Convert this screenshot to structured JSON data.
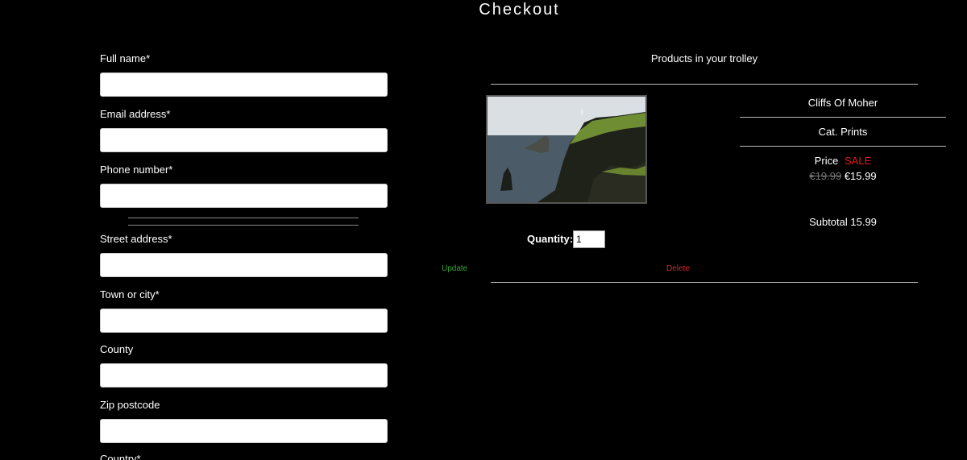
{
  "page": {
    "title": "Checkout"
  },
  "form": {
    "fields": [
      {
        "label": "Full name*",
        "value": ""
      },
      {
        "label": "Email address*",
        "value": ""
      },
      {
        "label": "Phone number*",
        "value": ""
      },
      {
        "label": "Street address*",
        "value": ""
      },
      {
        "label": "Town or city*",
        "value": ""
      },
      {
        "label": "County",
        "value": ""
      },
      {
        "label": "Zip postcode",
        "value": ""
      },
      {
        "label": "Country*",
        "value": ""
      }
    ]
  },
  "trolley": {
    "title": "Products in your trolley",
    "item": {
      "name": "Cliffs Of Moher",
      "category": "Cat. Prints",
      "price_label": "Price",
      "sale_label": "SALE",
      "old_price": "€19.99",
      "price": "€15.99",
      "subtotal": "Subtotal 15.99",
      "quantity_label": "Quantity:",
      "quantity_value": "1",
      "update_label": "Update",
      "delete_label": "Delete"
    }
  },
  "colors": {
    "background": "#000000",
    "sale": "#e21b1b",
    "update": "#3ba53b",
    "delete": "#d22b2b"
  }
}
